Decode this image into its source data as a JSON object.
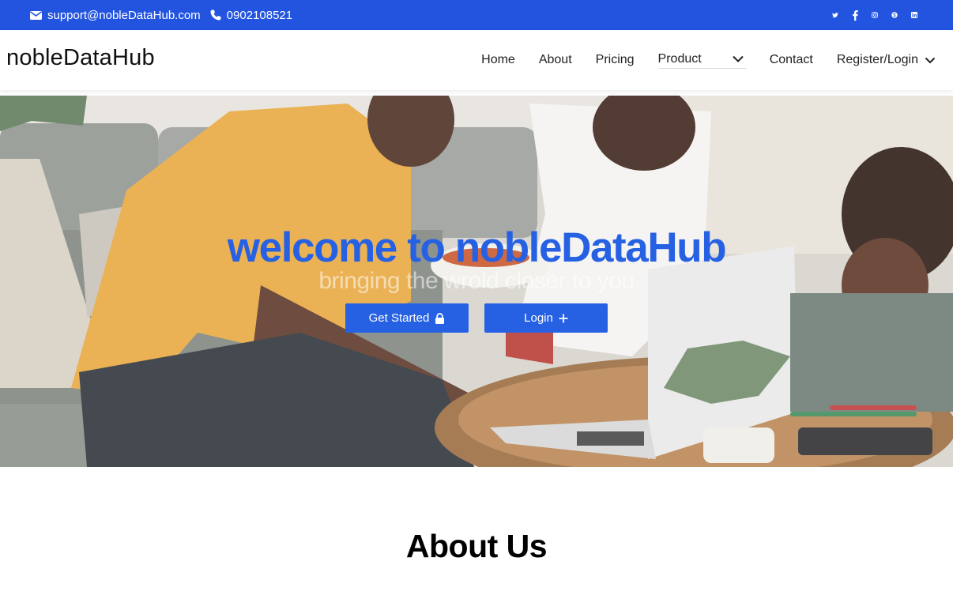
{
  "topbar": {
    "email": "support@nobleDataHub.com",
    "phone": "0902108521",
    "icons": [
      "envelope-icon",
      "phone-icon"
    ],
    "social": [
      "twitter-icon",
      "facebook-icon",
      "instagram-icon",
      "skype-icon",
      "linkedin-icon"
    ],
    "color": "#2254e0"
  },
  "nav": {
    "brand": "nobleDataHub",
    "items": [
      "Home",
      "About",
      "Pricing",
      "Product",
      "Contact",
      "Register/Login"
    ]
  },
  "hero": {
    "title": "welcome to nobleDataHub",
    "subtitle": "bringing the wrold closer to you",
    "get_started": "Get Started",
    "login": "Login",
    "accent": "#2761e3"
  },
  "about": {
    "heading": "About Us"
  }
}
